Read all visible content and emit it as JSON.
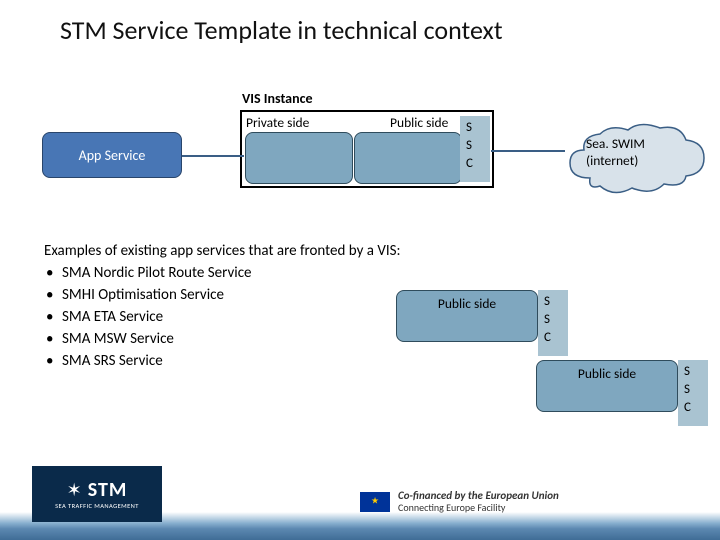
{
  "title": "STM Service Template in technical context",
  "vis_label": "VIS Instance",
  "private_label": "Private side",
  "public_label": "Public side",
  "ssc": [
    "S",
    "S",
    "C"
  ],
  "app_service": "App Service",
  "cloud": {
    "line1": "Sea. SWIM",
    "line2": "(internet)"
  },
  "examples": {
    "intro": "Examples of existing app services that are fronted by a VIS:",
    "items": [
      "SMA Nordic Pilot Route Service",
      "SMHI Optimisation Service",
      "SMA ETA Service",
      "SMA MSW Service",
      "SMA SRS Service"
    ]
  },
  "footer": {
    "stm_big": "STM",
    "stm_small": "SEA TRAFFIC MANAGEMENT",
    "cef_strong": "Co-financed by the European Union",
    "cef_sub": "Connecting Europe Facility"
  }
}
